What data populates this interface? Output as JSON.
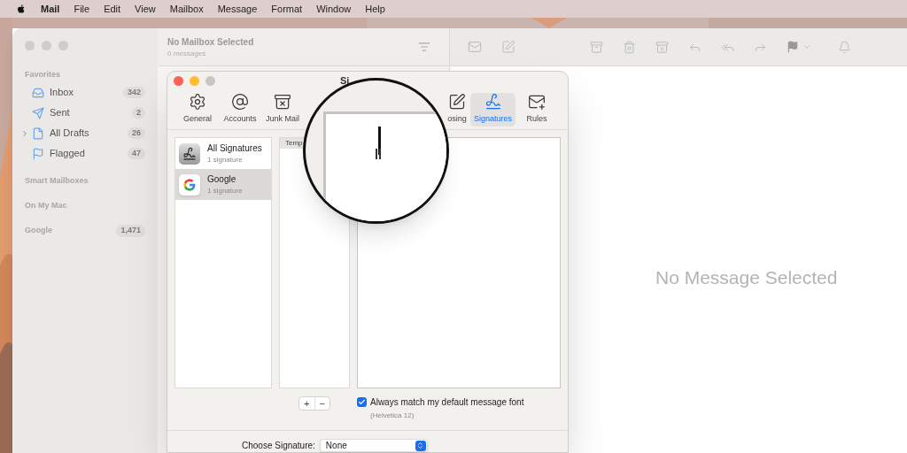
{
  "menu_bar": {
    "items": [
      "Mail",
      "File",
      "Edit",
      "View",
      "Mailbox",
      "Message",
      "Format",
      "Window",
      "Help"
    ]
  },
  "sidebar": {
    "sections": [
      {
        "title": "Favorites",
        "items": [
          {
            "label": "Inbox",
            "kind": "inbox",
            "count": "342",
            "disclosure": false
          },
          {
            "label": "Sent",
            "kind": "sent",
            "count": "2",
            "disclosure": false
          },
          {
            "label": "All Drafts",
            "kind": "drafts",
            "count": "26",
            "disclosure": true
          },
          {
            "label": "Flagged",
            "kind": "flagged",
            "count": "47",
            "disclosure": false
          }
        ]
      },
      {
        "title": "Smart Mailboxes"
      },
      {
        "title": "On My Mac"
      },
      {
        "title": "Google",
        "count": "1,471"
      }
    ]
  },
  "message_list": {
    "title": "No Mailbox Selected",
    "subtitle": "0 messages"
  },
  "content": {
    "empty_text": "No Message Selected"
  },
  "dialog": {
    "title": "Si",
    "tabs": [
      {
        "label": "General",
        "kind": "general",
        "selected": false
      },
      {
        "label": "Accounts",
        "kind": "accounts",
        "selected": false
      },
      {
        "label": "Junk Mail",
        "kind": "junk",
        "selected": false
      },
      {
        "label": "osing",
        "kind": "composing",
        "selected": false
      },
      {
        "label": "Signatures",
        "kind": "signatures",
        "selected": true
      },
      {
        "label": "Rules",
        "kind": "rules",
        "selected": false
      }
    ],
    "accounts": [
      {
        "name": "All Signatures",
        "subtitle": "1 signature",
        "kind": "all",
        "selected": false
      },
      {
        "name": "Google",
        "subtitle": "1 signature",
        "kind": "google",
        "selected": true
      }
    ],
    "signatures_header": "Temp",
    "add_button": "+",
    "remove_button": "−",
    "match_font": {
      "label": "Always match my default message font",
      "checked": true,
      "note": "(Helvetica 12)"
    },
    "choose_signature": {
      "label": "Choose Signature:",
      "value": "None"
    }
  }
}
